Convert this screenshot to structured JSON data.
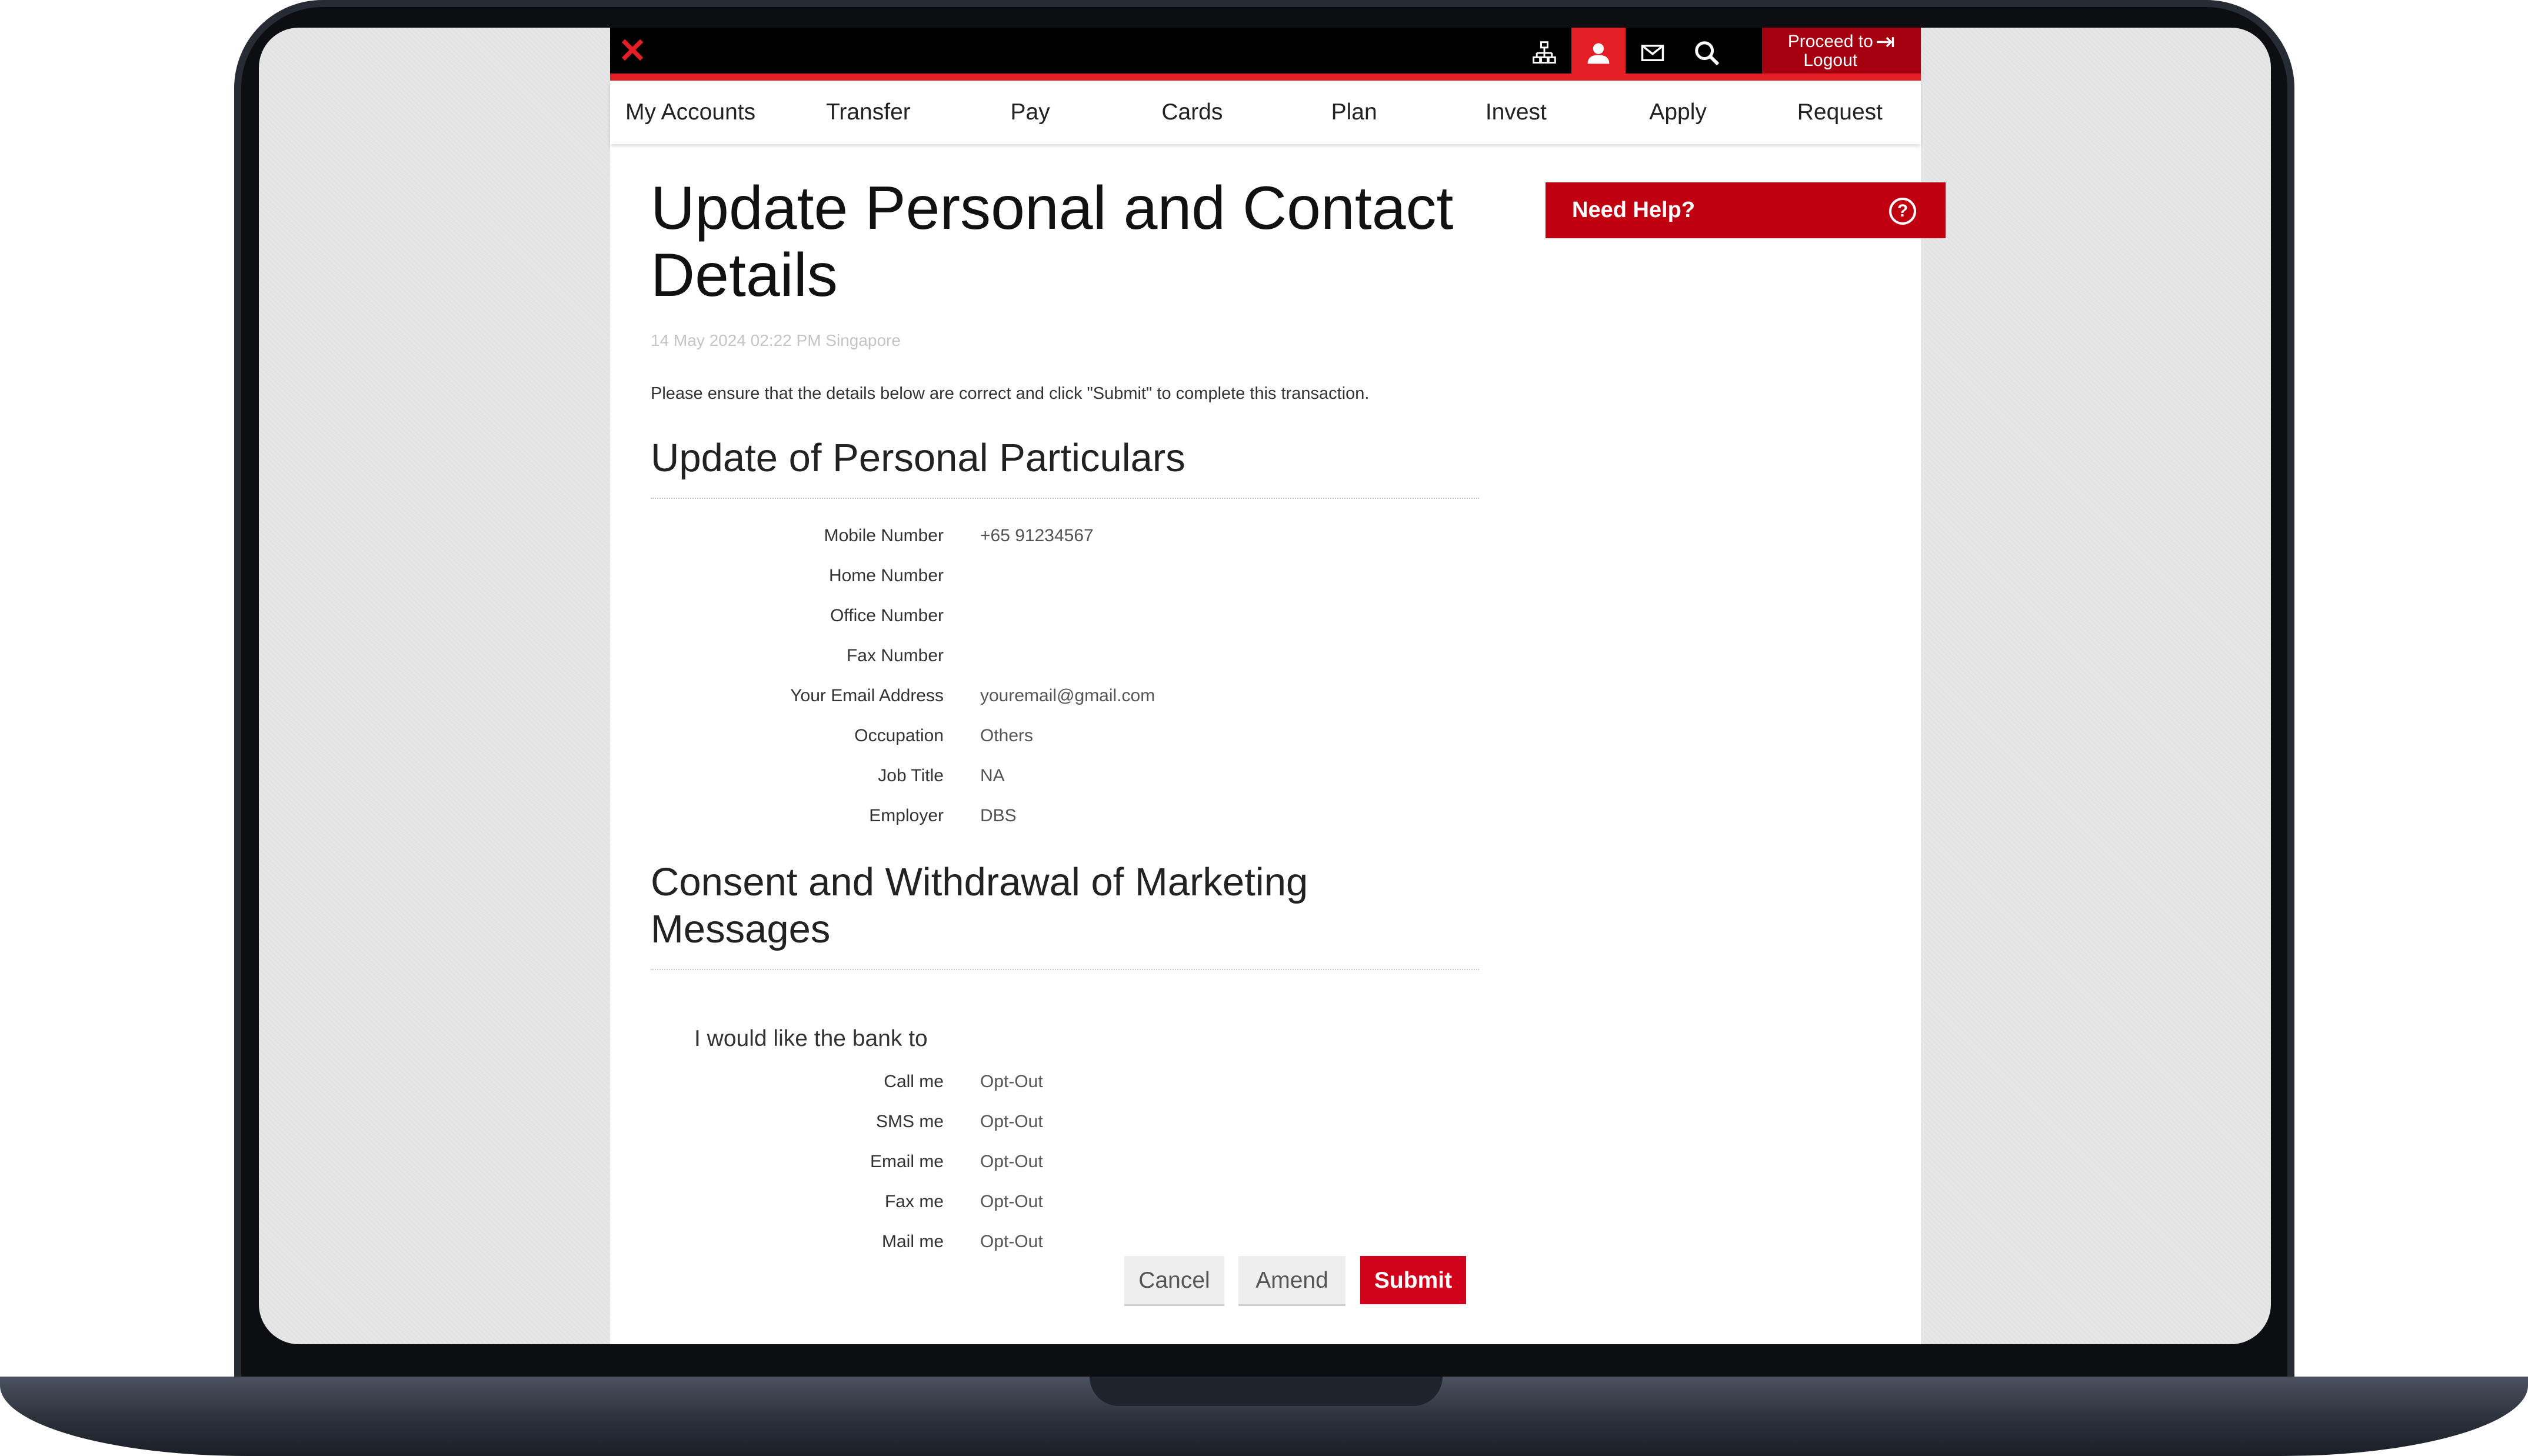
{
  "header": {
    "logo_icon": "dbs-logo-icon",
    "icons": [
      "sitemap-icon",
      "profile-icon",
      "mail-icon",
      "search-icon"
    ],
    "logout_line1": "Proceed to",
    "logout_line2": "Logout"
  },
  "nav": [
    "My Accounts",
    "Transfer",
    "Pay",
    "Cards",
    "Plan",
    "Invest",
    "Apply",
    "Request"
  ],
  "page": {
    "title_line1": "Update Personal and Contact",
    "title_line2": "Details",
    "timestamp": "14 May 2024 02:22 PM Singapore",
    "instruction": "Please ensure that the details below are correct and click \"Submit\" to complete this transaction."
  },
  "personal": {
    "heading": "Update of Personal Particulars",
    "rows": [
      {
        "label": "Mobile Number",
        "value": "+65 91234567"
      },
      {
        "label": "Home Number",
        "value": ""
      },
      {
        "label": "Office Number",
        "value": ""
      },
      {
        "label": "Fax Number",
        "value": ""
      },
      {
        "label": "Your Email Address",
        "value": "youremail@gmail.com"
      },
      {
        "label": "Occupation",
        "value": "Others"
      },
      {
        "label": "Job Title",
        "value": "NA"
      },
      {
        "label": "Employer",
        "value": "DBS"
      }
    ]
  },
  "consent": {
    "heading_line1": "Consent and Withdrawal of Marketing",
    "heading_line2": "Messages",
    "subheading": "I would like the bank to",
    "rows": [
      {
        "label": "Call me",
        "value": "Opt-Out"
      },
      {
        "label": "SMS me",
        "value": "Opt-Out"
      },
      {
        "label": "Email me",
        "value": "Opt-Out"
      },
      {
        "label": "Fax me",
        "value": "Opt-Out"
      },
      {
        "label": "Mail me",
        "value": "Opt-Out"
      }
    ]
  },
  "buttons": {
    "cancel": "Cancel",
    "amend": "Amend",
    "submit": "Submit"
  },
  "help": {
    "label": "Need Help?",
    "icon": "question-icon"
  },
  "colors": {
    "brand_red": "#e31e24",
    "button_red": "#d0021b",
    "help_red": "#c00010"
  }
}
